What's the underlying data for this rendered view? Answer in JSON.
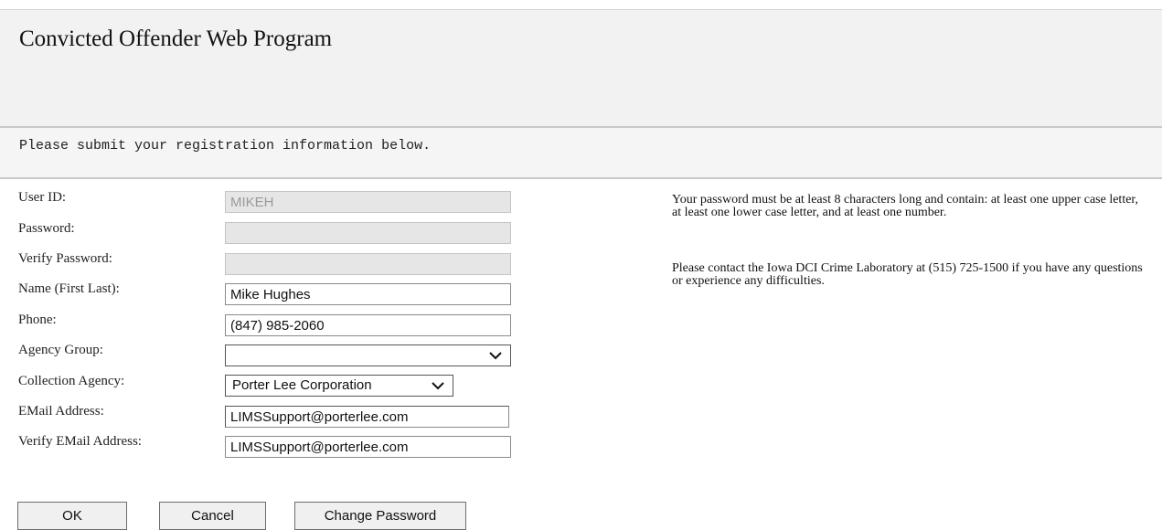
{
  "header": {
    "title": "Convicted Offender Web Program"
  },
  "instructions": "Please submit your registration information below.",
  "form": {
    "user_id": {
      "label": "User ID:",
      "value": "MIKEH"
    },
    "password": {
      "label": "Password:",
      "value": ""
    },
    "verify_password": {
      "label": "Verify Password:",
      "value": ""
    },
    "name": {
      "label": "Name (First Last):",
      "value": "Mike Hughes"
    },
    "phone": {
      "label": "Phone:",
      "value": "(847) 985-2060"
    },
    "agency_group": {
      "label": "Agency Group:",
      "value": ""
    },
    "collection_agency": {
      "label": "Collection Agency:",
      "value": "Porter Lee Corporation"
    },
    "email": {
      "label": "EMail Address:",
      "value": "LIMSSupport@porterlee.com"
    },
    "verify_email": {
      "label": "Verify EMail Address:",
      "value": "LIMSSupport@porterlee.com"
    }
  },
  "info": {
    "password_rules": "Your password must be at least 8 characters long and contain: at least one upper case letter, at least one lower case letter, and at least one number.",
    "contact": "Please contact the Iowa DCI Crime Laboratory at (515) 725-1500 if you have any questions or experience any difficulties."
  },
  "buttons": {
    "ok": "OK",
    "cancel": "Cancel",
    "change_password": "Change Password"
  },
  "icons": {
    "dropdown": "chevron-down-icon"
  }
}
